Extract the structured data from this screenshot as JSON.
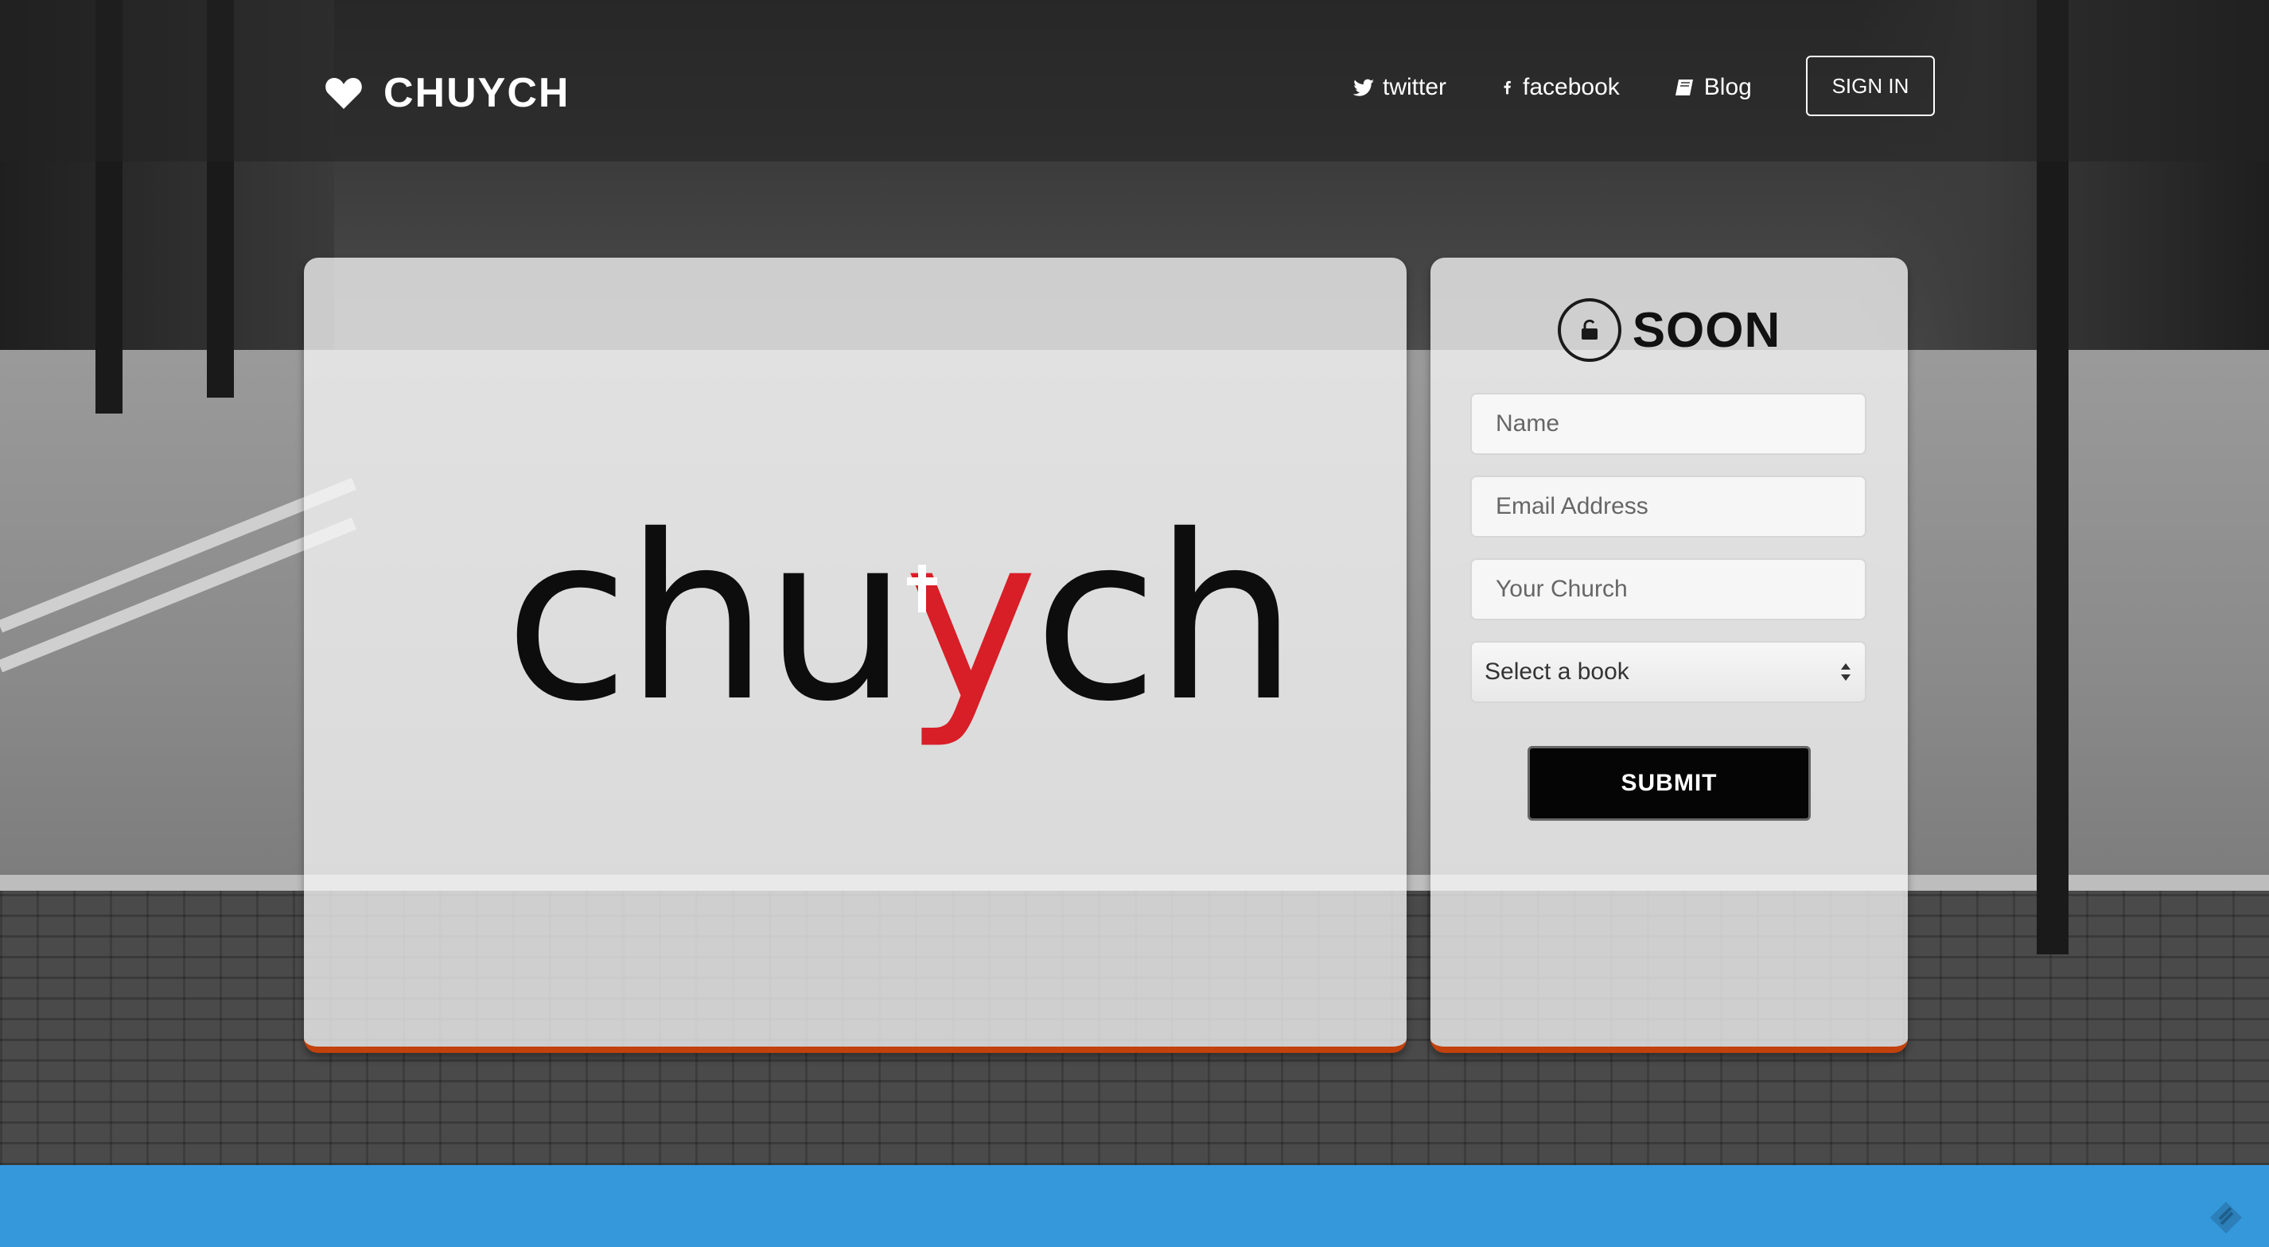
{
  "brand": {
    "name": "CHUYCH",
    "icon": "heart-icon"
  },
  "nav": {
    "links": [
      {
        "label": "twitter",
        "icon": "twitter-icon"
      },
      {
        "label": "facebook",
        "icon": "facebook-icon"
      },
      {
        "label": "Blog",
        "icon": "book-icon"
      }
    ],
    "signin_label": "SIGN IN"
  },
  "hero": {
    "logo_text_before": "chu",
    "logo_text_y": "y",
    "logo_text_after": "ch"
  },
  "signup": {
    "title": "SOON",
    "title_icon": "lock-icon",
    "name_placeholder": "Name",
    "email_placeholder": "Email Address",
    "church_placeholder": "Your Church",
    "book_select_value": "Select a book",
    "submit_label": "SUBMIT"
  },
  "colors": {
    "accent_underline": "#c2410c",
    "logo_red": "#d81e27",
    "bottom_bar": "#3498db"
  }
}
